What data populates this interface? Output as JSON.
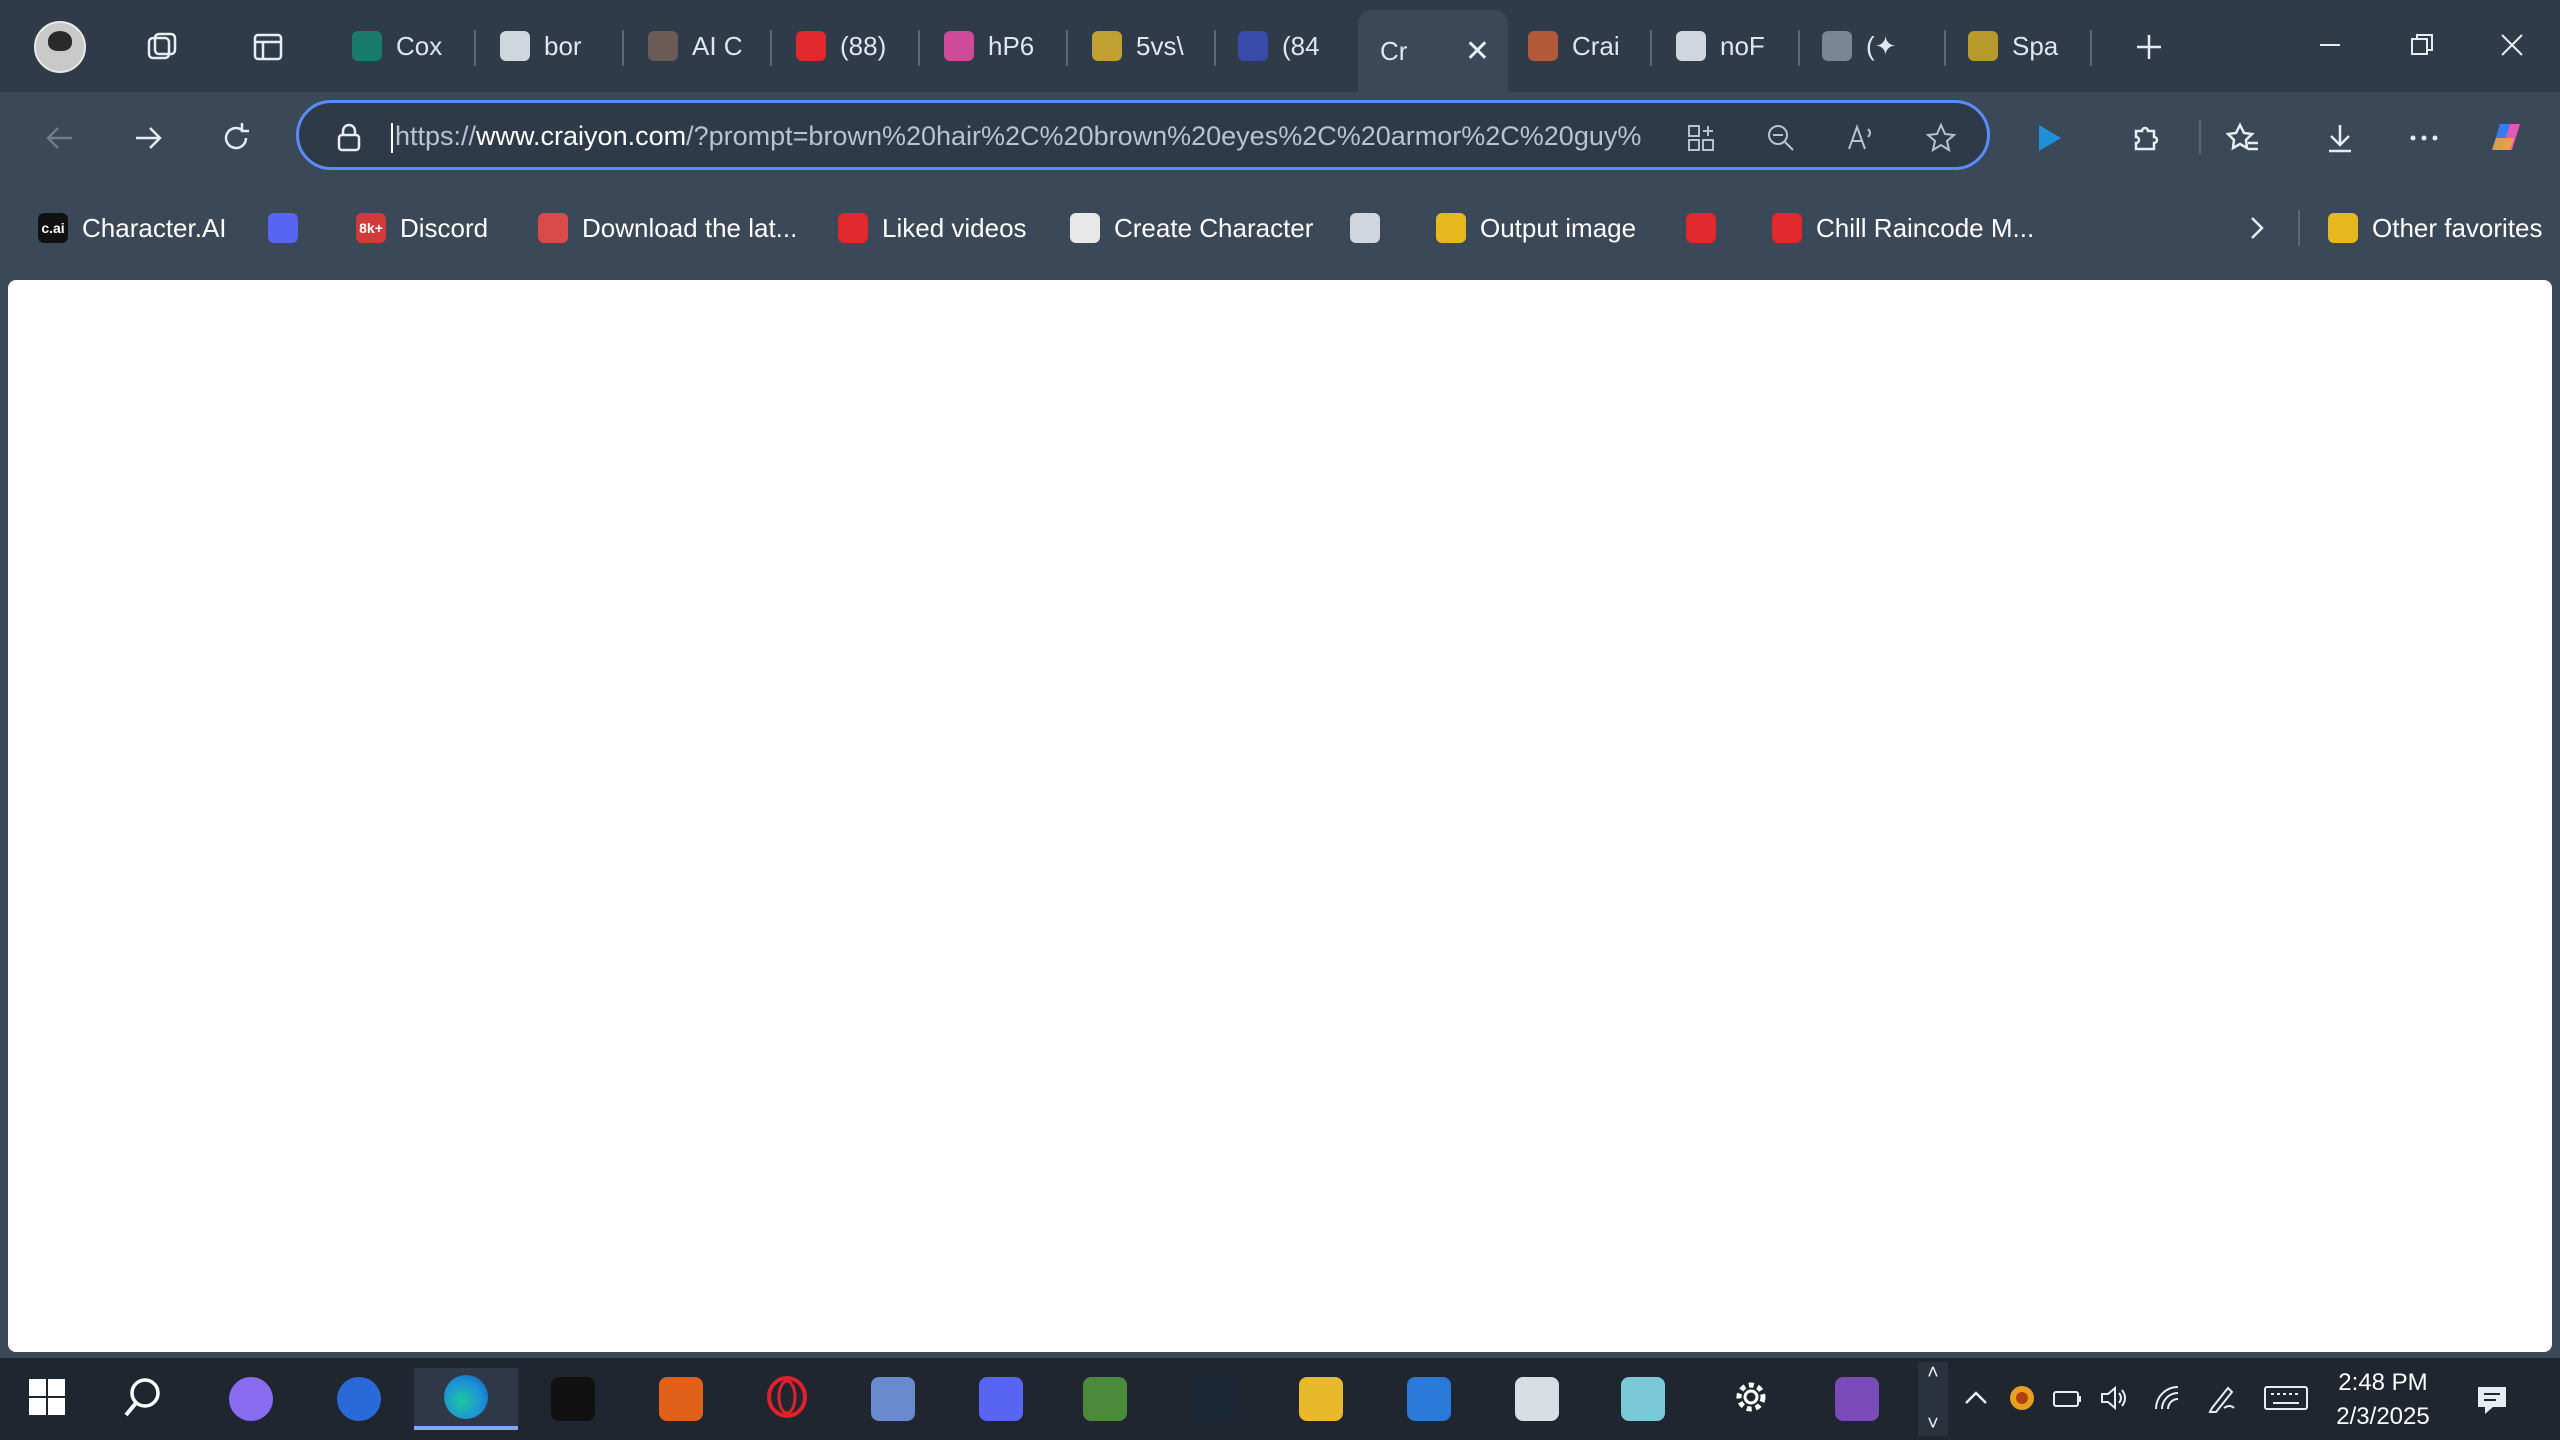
{
  "tabs": [
    {
      "label": "Cox",
      "color": "#1a7a6e"
    },
    {
      "label": "bor",
      "color": "#cfd6de"
    },
    {
      "label": "AI C",
      "color": "#6b5a55"
    },
    {
      "label": "(88)",
      "color": "#e0282d"
    },
    {
      "label": "hP6",
      "color": "#d04a9a"
    },
    {
      "label": "5vs\\",
      "color": "#c0a030"
    },
    {
      "label": "(84",
      "color": "#3a4aa8"
    },
    {
      "label": "Cr",
      "color": "#3b4858"
    },
    {
      "label": "Crai",
      "color": "#b35a3a"
    },
    {
      "label": "noF",
      "color": "#cfd6de"
    },
    {
      "label": "(✦",
      "color": "#7a8694"
    },
    {
      "label": "Spa",
      "color": "#b89a2a"
    }
  ],
  "address": {
    "scheme": "https://",
    "host": "www.craiyon.com",
    "path": "/?prompt=brown%20hair%2C%20brown%20eyes%2C%20armor%2C%20guy%"
  },
  "favorites": [
    {
      "label": "Character.AI",
      "icon": "c.ai",
      "color": "#111111"
    },
    {
      "label": "",
      "icon": "discord-icon",
      "color": "#5865f2"
    },
    {
      "label": "Discord",
      "icon": "8k+",
      "color": "#d03a3a"
    },
    {
      "label": "Download the lat...",
      "icon": "store-icon",
      "color": "#d94b4b"
    },
    {
      "label": "Liked videos",
      "icon": "youtube-icon",
      "color": "#e0282d"
    },
    {
      "label": "Create Character",
      "icon": "openai-icon",
      "color": "#e8e8e8"
    },
    {
      "label": "",
      "icon": "page-icon",
      "color": "#cfd6de"
    },
    {
      "label": "Output image",
      "icon": "y-icon",
      "color": "#e6b81e"
    },
    {
      "label": "",
      "icon": "youtube-icon",
      "color": "#e0282d"
    },
    {
      "label": "Chill Raincode M...",
      "icon": "youtube-icon",
      "color": "#e0282d"
    }
  ],
  "other_favorites": "Other favorites",
  "clock": {
    "time": "2:48 PM",
    "date": "2/3/2025"
  },
  "taskbar_apps": [
    {
      "name": "start",
      "color": "#ffffff"
    },
    {
      "name": "search",
      "color": "#ffffff"
    },
    {
      "name": "copilot",
      "color": "#8a6cf0"
    },
    {
      "name": "firefox",
      "color": "#2a6ad8"
    },
    {
      "name": "edge",
      "color": "#1e90d8"
    },
    {
      "name": "tiktok",
      "color": "#111111"
    },
    {
      "name": "app-orange",
      "color": "#e0601a"
    },
    {
      "name": "opera",
      "color": "#d0202a"
    },
    {
      "name": "paint",
      "color": "#6a8ad0"
    },
    {
      "name": "discord",
      "color": "#5865f2"
    },
    {
      "name": "minecraft",
      "color": "#4a8a3a"
    },
    {
      "name": "steam",
      "color": "#1b2838"
    },
    {
      "name": "file-explorer",
      "color": "#e8b92a"
    },
    {
      "name": "ms-store",
      "color": "#2a78d8"
    },
    {
      "name": "roblox",
      "color": "#d8dde4"
    },
    {
      "name": "app-cyan",
      "color": "#7ac8d8"
    },
    {
      "name": "settings",
      "color": "#ffffff"
    },
    {
      "name": "game-avatar",
      "color": "#7a4ab8"
    }
  ]
}
